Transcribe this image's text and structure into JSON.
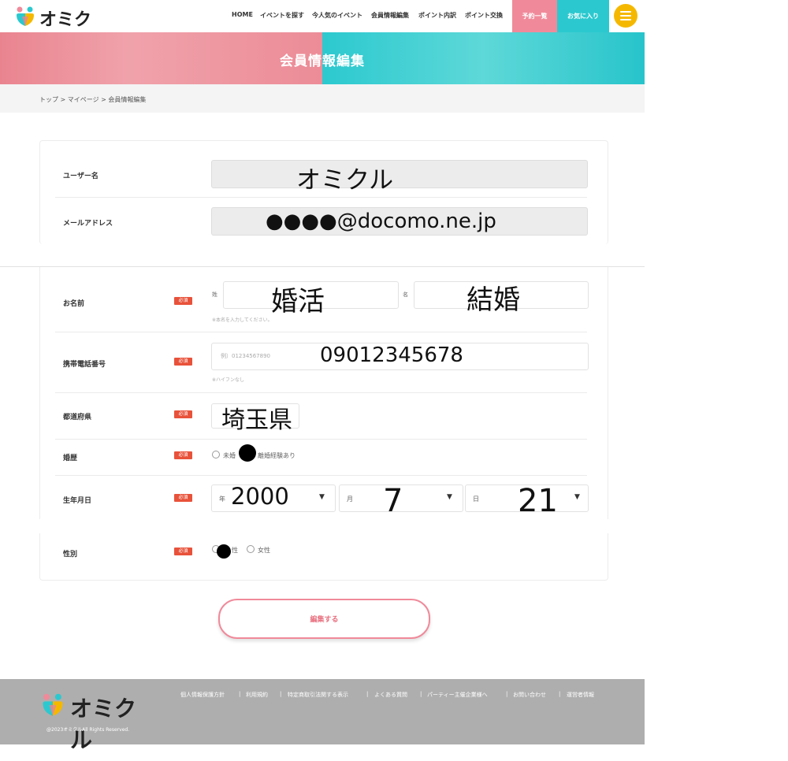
{
  "brand": {
    "name": "オミクル",
    "footer_name": "オミクル"
  },
  "nav": {
    "items": [
      "HOME",
      "イベントを探す",
      "今人気のイベント",
      "会員情報編集",
      "ポイント内訳",
      "ポイント交換"
    ],
    "reserve_label": "予約一覧",
    "favorite_label": "お気に入り"
  },
  "banner": {
    "title": "会員情報編集"
  },
  "breadcrumb": "トップ > マイページ > 会員情報編集",
  "form": {
    "required_badge": "必須",
    "username": {
      "label": "ユーザー名",
      "value": "オミクル"
    },
    "email": {
      "label": "メールアドレス",
      "value": "●●●●@docomo.ne.jp"
    },
    "name": {
      "label": "お名前",
      "last_label": "姓",
      "last_value": "婚活",
      "first_label": "名",
      "first_value": "結婚",
      "hint": "※本名を入力してください。"
    },
    "phone": {
      "label": "携帯電話番号",
      "placeholder": "例）01234567890",
      "value": "09012345678",
      "hint": "※ハイフンなし"
    },
    "prefecture": {
      "label": "都道府県",
      "value": "埼玉県"
    },
    "marital": {
      "label": "婚歴",
      "option1": "未婚",
      "option2": "離婚経験あり",
      "selected": "離婚経験あり"
    },
    "birthday": {
      "label": "生年月日",
      "year_label": "年",
      "year_value": "2000",
      "month_label": "月",
      "month_value": "7",
      "day_label": "日",
      "day_value": "21"
    },
    "gender": {
      "label": "性別",
      "option1": "男性",
      "option1_visible": "性",
      "option2": "女性",
      "selected": "男性"
    }
  },
  "submit_label": "編集する",
  "footer": {
    "links": [
      "個人情報保護方針",
      "利用規約",
      "特定商取引法関する表示",
      "よくある質問",
      "パーティー主催企業様へ",
      "お問い合わせ",
      "運営者情報"
    ],
    "copyright": "@2023オミクルAll Rights Reserved."
  },
  "colors": {
    "pink": "#f08a9a",
    "teal": "#2bc9cf",
    "required": "#e8523a",
    "menu": "#f5b800"
  },
  "icons": [
    "omikuru-logo-icon",
    "menu-icon",
    "caret-down-icon",
    "radio-icon"
  ]
}
